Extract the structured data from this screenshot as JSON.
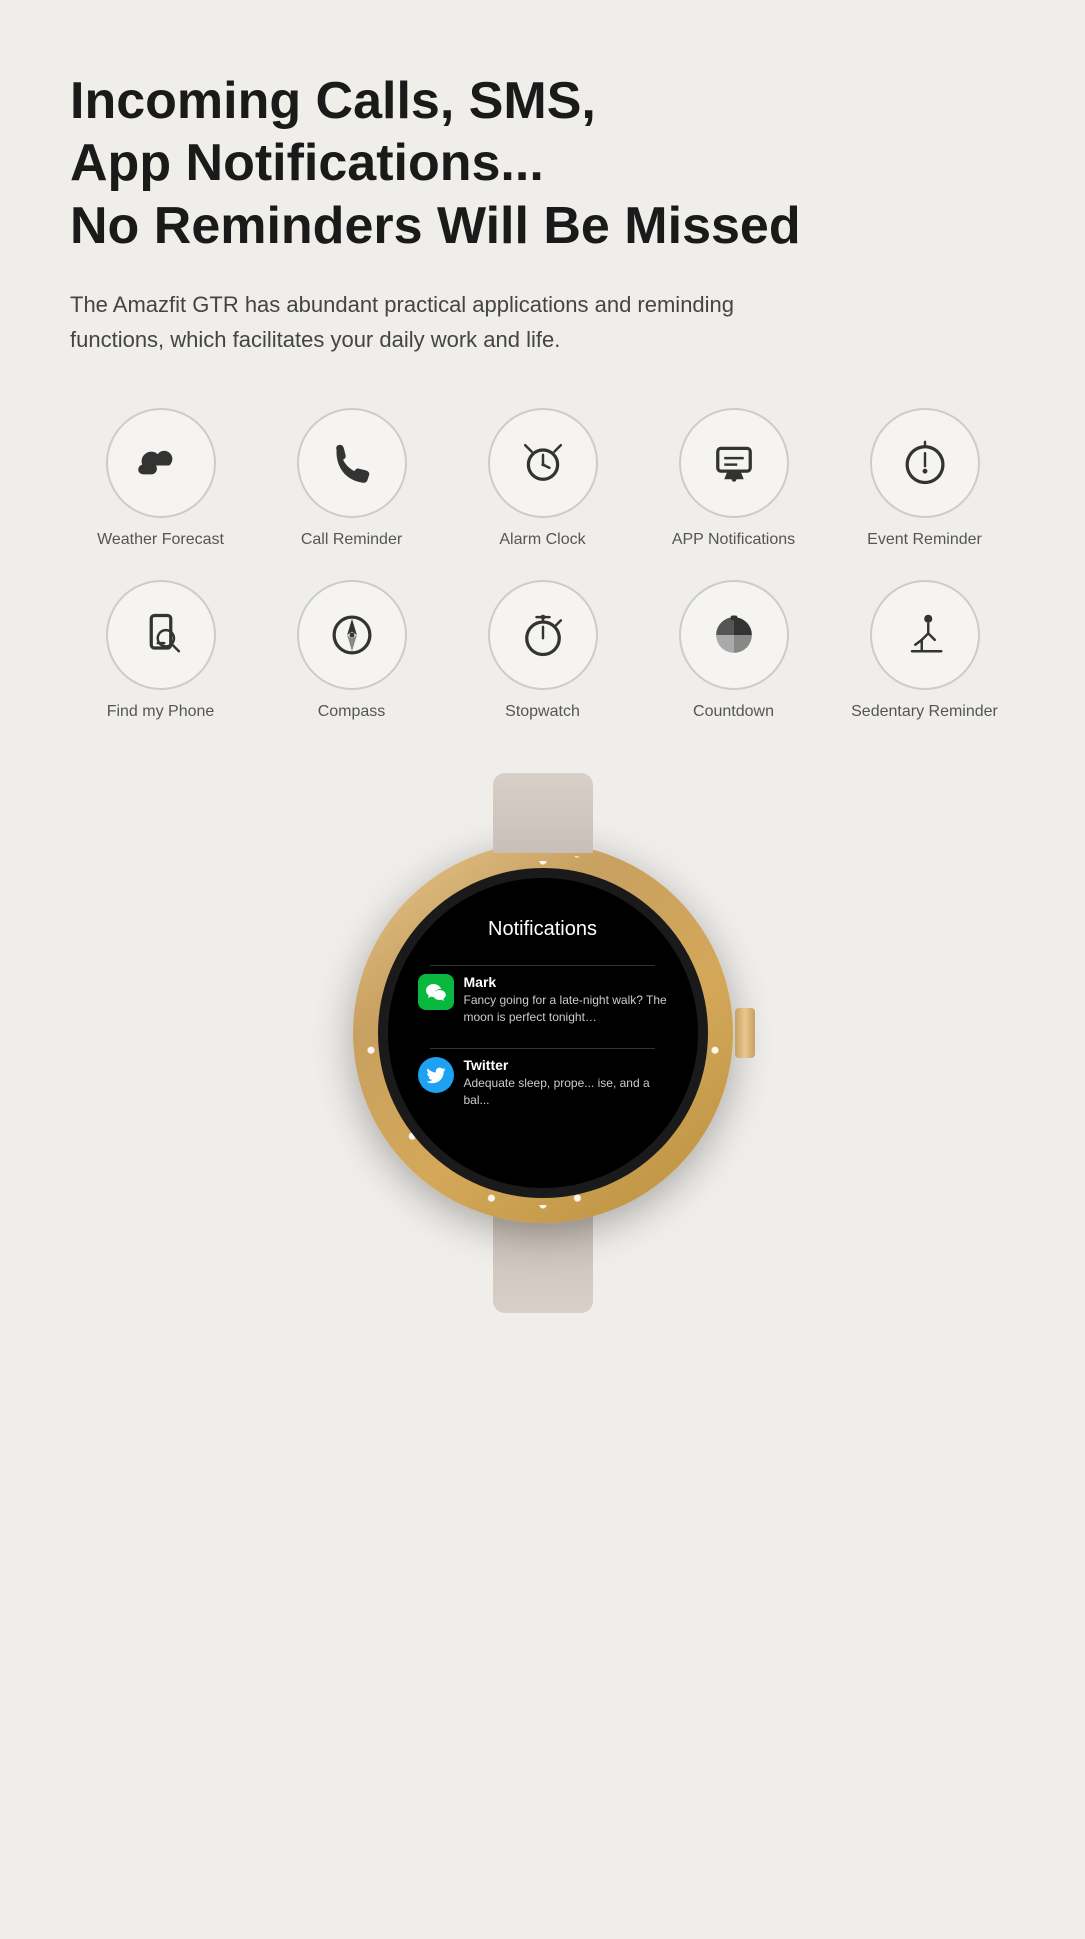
{
  "headline": {
    "line1": "Incoming Calls, SMS,",
    "line2": "App Notifications...",
    "line3": "No Reminders Will Be Missed"
  },
  "subtext": "The Amazfit GTR has abundant practical applications and reminding functions, which facilitates your daily work and life.",
  "icons_row1": [
    {
      "id": "weather-forecast",
      "label": "Weather Forecast",
      "icon": "weather"
    },
    {
      "id": "call-reminder",
      "label": "Call Reminder",
      "icon": "call"
    },
    {
      "id": "alarm-clock",
      "label": "Alarm Clock",
      "icon": "alarm"
    },
    {
      "id": "app-notifications",
      "label": "APP Notifications",
      "icon": "notifications"
    },
    {
      "id": "event-reminder",
      "label": "Event Reminder",
      "icon": "event"
    }
  ],
  "icons_row2": [
    {
      "id": "find-my-phone",
      "label": "Find my Phone",
      "icon": "find-phone"
    },
    {
      "id": "compass",
      "label": "Compass",
      "icon": "compass"
    },
    {
      "id": "stopwatch",
      "label": "Stopwatch",
      "icon": "stopwatch"
    },
    {
      "id": "countdown",
      "label": "Countdown",
      "icon": "countdown"
    },
    {
      "id": "sedentary-reminder",
      "label": "Sedentary Reminder",
      "icon": "sedentary"
    }
  ],
  "watch": {
    "screen_title": "Notifications",
    "notification1": {
      "app": "Mark",
      "icon": "wechat",
      "message": "Fancy going for a late-night walk? The moon is perfect tonight…"
    },
    "notification2": {
      "app": "Twitter",
      "icon": "twitter",
      "message": "Adequate sleep, prope... ise, and a bal..."
    }
  }
}
